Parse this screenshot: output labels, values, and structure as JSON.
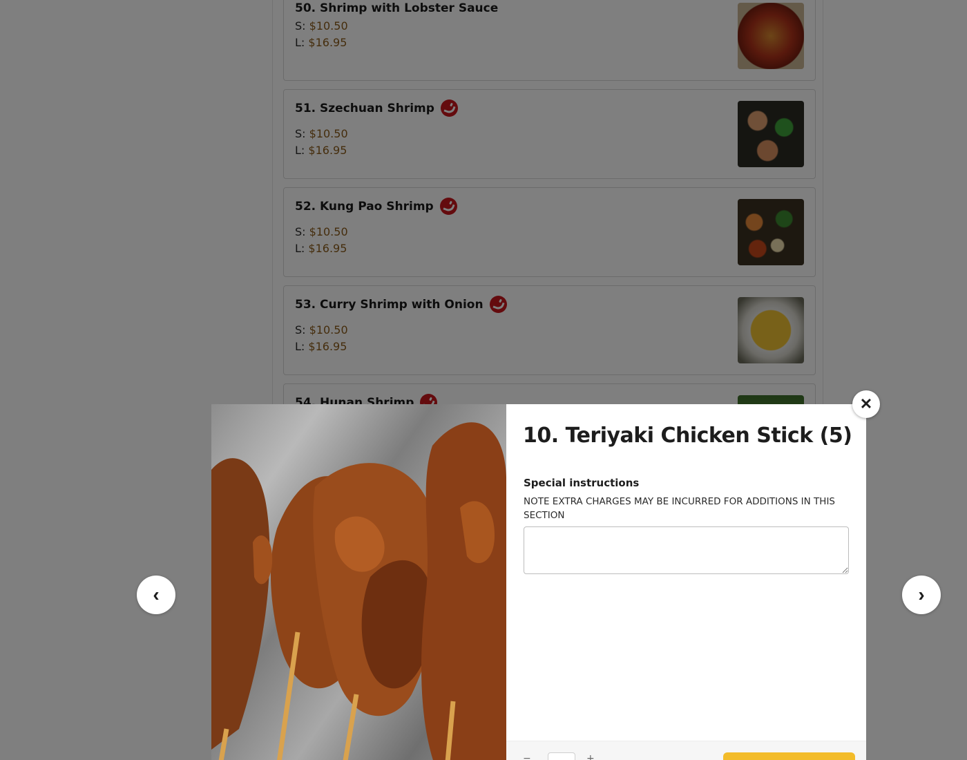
{
  "menu": {
    "items": [
      {
        "name": "50. Shrimp with Lobster Sauce",
        "spicy": false,
        "small_label": "S:",
        "small_price": "$10.50",
        "large_label": "L:",
        "large_price": "$16.95",
        "image": "shrimp-lobster-sauce-photo"
      },
      {
        "name": "51. Szechuan Shrimp",
        "spicy": true,
        "small_label": "S:",
        "small_price": "$10.50",
        "large_label": "L:",
        "large_price": "$16.95",
        "image": "szechuan-shrimp-photo"
      },
      {
        "name": "52. Kung Pao Shrimp",
        "spicy": true,
        "small_label": "S:",
        "small_price": "$10.50",
        "large_label": "L:",
        "large_price": "$16.95",
        "image": "kung-pao-shrimp-photo"
      },
      {
        "name": "53. Curry Shrimp with Onion",
        "spicy": true,
        "small_label": "S:",
        "small_price": "$10.50",
        "large_label": "L:",
        "large_price": "$16.95",
        "image": "curry-shrimp-photo"
      },
      {
        "name": "54. Hunan Shrimp",
        "spicy": true,
        "image": "hunan-shrimp-photo"
      }
    ]
  },
  "modal": {
    "title": "10. Teriyaki Chicken Stick (5)",
    "image": "teriyaki-chicken-stick-photo",
    "special_instructions_label": "Special instructions",
    "special_instructions_note": "NOTE EXTRA CHARGES MAY BE INCURRED FOR ADDITIONS IN THIS SECTION",
    "special_instructions_value": "",
    "close_icon": "close-icon",
    "prev_icon": "chevron-left-icon",
    "next_icon": "chevron-right-icon"
  },
  "colors": {
    "spicy_badge": "#c8161d",
    "price_text": "#8a5a18",
    "overlay": "rgba(0,0,0,0.5)",
    "add_button": "#f3bc2a"
  }
}
